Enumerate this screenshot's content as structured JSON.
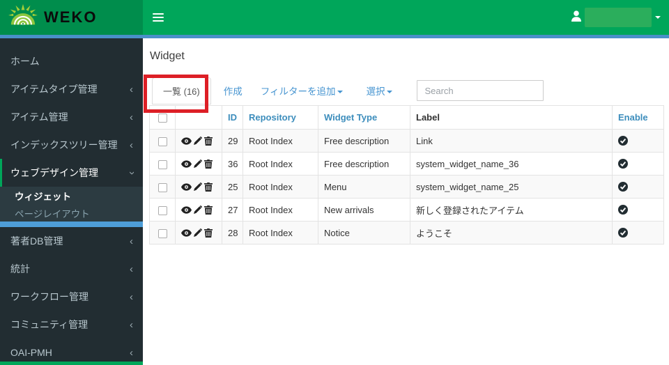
{
  "colors": {
    "navbar_green": "#00a65a",
    "logo_green": "#008d4c",
    "sidebar_dark": "#222d32",
    "submenu_dark": "#2c3b41",
    "accent_blue": "#3c8dbc",
    "top_blue_line": "#4a90c8",
    "sidebar_blue_bar": "#4e9ed8",
    "annotation_red": "#dd1f26",
    "link_blue": "#4795d1"
  },
  "header": {
    "brand": "WEKO"
  },
  "sidebar": {
    "items": [
      {
        "label": "ホーム",
        "chevron": ""
      },
      {
        "label": "アイテムタイプ管理",
        "chevron": "‹"
      },
      {
        "label": "アイテム管理",
        "chevron": "‹"
      },
      {
        "label": "インデックスツリー管理",
        "chevron": "‹"
      },
      {
        "label": "ウェブデザイン管理",
        "chevron": "‹",
        "expanded": true
      },
      {
        "label": "著者DB管理",
        "chevron": "‹"
      },
      {
        "label": "統計",
        "chevron": "‹"
      },
      {
        "label": "ワークフロー管理",
        "chevron": "‹"
      },
      {
        "label": "コミュニティ管理",
        "chevron": "‹"
      },
      {
        "label": "OAI-PMH",
        "chevron": "‹"
      }
    ],
    "submenu": [
      {
        "label": "ウィジェット",
        "active": true
      },
      {
        "label": "ページレイアウト",
        "active": false
      }
    ]
  },
  "main": {
    "title": "Widget",
    "tabs": {
      "list_tab": "一覧 (16)"
    },
    "actions": {
      "create": "作成",
      "add_filter": "フィルターを追加",
      "select": "選択"
    },
    "search": {
      "placeholder": "Search"
    },
    "table": {
      "columns": {
        "id": "ID",
        "repository": "Repository",
        "widget_type": "Widget Type",
        "label": "Label",
        "enable": "Enable"
      },
      "rows": [
        {
          "id": "29",
          "repository": "Root Index",
          "widget_type": "Free description",
          "label": "Link",
          "enabled": true
        },
        {
          "id": "36",
          "repository": "Root Index",
          "widget_type": "Free description",
          "label": "system_widget_name_36",
          "enabled": true
        },
        {
          "id": "25",
          "repository": "Root Index",
          "widget_type": "Menu",
          "label": "system_widget_name_25",
          "enabled": true
        },
        {
          "id": "27",
          "repository": "Root Index",
          "widget_type": "New arrivals",
          "label": "新しく登録されたアイテム",
          "enabled": true
        },
        {
          "id": "28",
          "repository": "Root Index",
          "widget_type": "Notice",
          "label": "ようこそ",
          "enabled": true
        }
      ]
    }
  }
}
